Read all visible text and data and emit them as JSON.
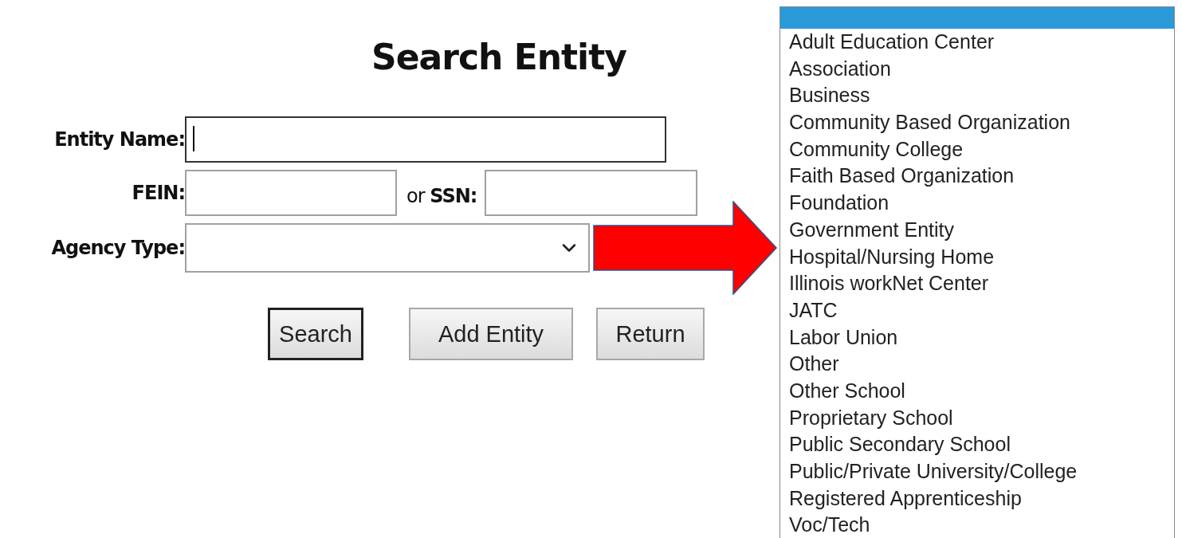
{
  "title": "Search Entity",
  "fields": [
    {
      "label": "Entity Name:",
      "focused": true
    },
    {
      "label": "FEIN:",
      "focused": false
    },
    {
      "label": "or **SSN:**",
      "focused": false
    },
    {
      "label": "Agency Type:",
      "focused": false
    }
  ],
  "buttons": [
    {
      "label": "Search",
      "default": true
    },
    {
      "label": "Add Entity",
      "default": false
    },
    {
      "label": "Return",
      "default": false
    }
  ],
  "agency_type_options": [
    {
      "selected": true
    },
    {
      "label": "Adult Education Center",
      "selected": false
    },
    {
      "label": "Association",
      "selected": false
    },
    {
      "label": "Business",
      "selected": false
    },
    {
      "label": "Community Based Organization",
      "selected": false
    },
    {
      "label": "Community College",
      "selected": false
    },
    {
      "label": "Faith Based Organization",
      "selected": false
    },
    {
      "label": "Foundation",
      "selected": false
    },
    {
      "label": "Government Entity",
      "selected": false
    },
    {
      "label": "Hospital/Nursing Home",
      "selected": false
    },
    {
      "label": "Illinois workNet Center",
      "selected": false
    },
    {
      "label": "JATC",
      "selected": false
    },
    {
      "label": "Labor Union",
      "selected": false
    },
    {
      "label": "Other",
      "selected": false
    },
    {
      "label": "Other School",
      "selected": false
    },
    {
      "label": "Proprietary School",
      "selected": false
    },
    {
      "label": "Public Secondary School",
      "selected": false
    },
    {
      "label": "Public/Private University/College",
      "selected": false
    },
    {
      "label": "Registered Apprenticeship",
      "selected": false
    },
    {
      "label": "Voc/Tech",
      "selected": false
    }
  ]
}
